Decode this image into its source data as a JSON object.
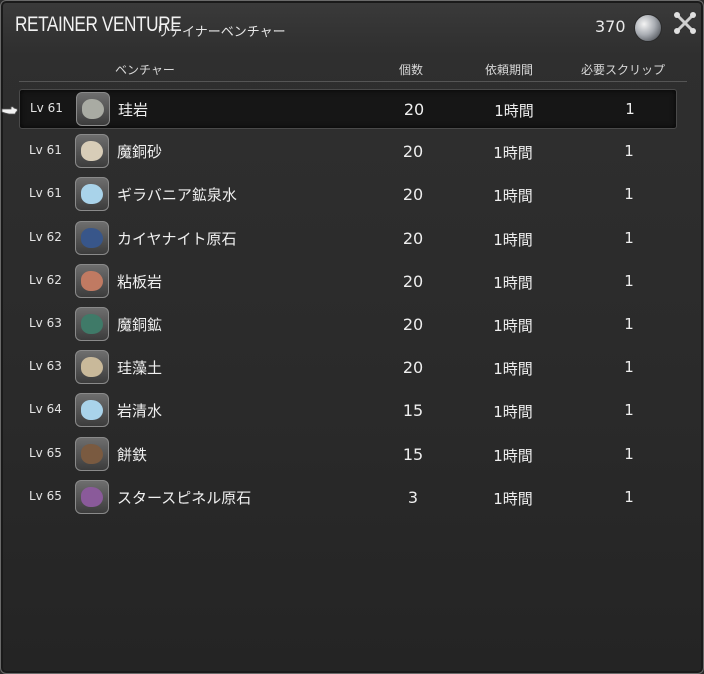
{
  "window": {
    "title_en": "RETAINER VENTURE",
    "title_jp": "リテイナーベンチャー",
    "currency_amount": "370",
    "currency_icon": "coin-icon",
    "settings_icon": "crossed-tools-icon"
  },
  "columns": {
    "venture": "ベンチャー",
    "quantity": "個数",
    "duration": "依頼期間",
    "cost": "必要スクリップ"
  },
  "selected_index": 0,
  "ventures": [
    {
      "level": "Lv 61",
      "name": "珪岩",
      "quantity": "20",
      "duration": "1時間",
      "cost": "1",
      "icon": "stone-icon",
      "icon_color": "#a9aba3"
    },
    {
      "level": "Lv 61",
      "name": "魔銅砂",
      "quantity": "20",
      "duration": "1時間",
      "cost": "1",
      "icon": "sand-icon",
      "icon_color": "#d8cdb8"
    },
    {
      "level": "Lv 61",
      "name": "ギラバニア鉱泉水",
      "quantity": "20",
      "duration": "1時間",
      "cost": "1",
      "icon": "water-bottle-icon",
      "icon_color": "#a9d3ea"
    },
    {
      "level": "Lv 62",
      "name": "カイヤナイト原石",
      "quantity": "20",
      "duration": "1時間",
      "cost": "1",
      "icon": "ore-icon",
      "icon_color": "#38568a"
    },
    {
      "level": "Lv 62",
      "name": "粘板岩",
      "quantity": "20",
      "duration": "1時間",
      "cost": "1",
      "icon": "slate-icon",
      "icon_color": "#c07a62"
    },
    {
      "level": "Lv 63",
      "name": "魔銅鉱",
      "quantity": "20",
      "duration": "1時間",
      "cost": "1",
      "icon": "ore-icon",
      "icon_color": "#3f7a68"
    },
    {
      "level": "Lv 63",
      "name": "珪藻土",
      "quantity": "20",
      "duration": "1時間",
      "cost": "1",
      "icon": "sack-icon",
      "icon_color": "#c9b99a"
    },
    {
      "level": "Lv 64",
      "name": "岩清水",
      "quantity": "15",
      "duration": "1時間",
      "cost": "1",
      "icon": "water-bottle-icon",
      "icon_color": "#a9d3ea"
    },
    {
      "level": "Lv 65",
      "name": "餅鉄",
      "quantity": "15",
      "duration": "1時間",
      "cost": "1",
      "icon": "iron-icon",
      "icon_color": "#7a5a40"
    },
    {
      "level": "Lv 65",
      "name": "スタースピネル原石",
      "quantity": "3",
      "duration": "1時間",
      "cost": "1",
      "icon": "gem-ore-icon",
      "icon_color": "#8a5a9a"
    }
  ]
}
